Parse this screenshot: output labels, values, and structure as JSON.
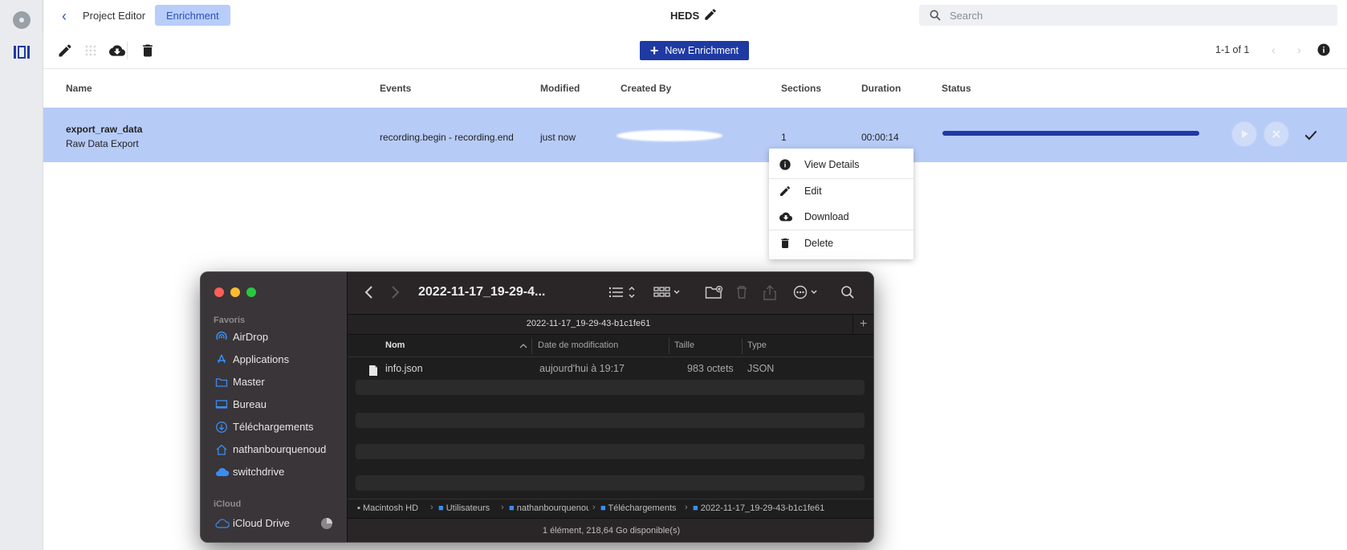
{
  "header": {
    "breadcrumb_project_editor": "Project Editor",
    "breadcrumb_enrichment": "Enrichment",
    "project_title": "HEDS",
    "search_placeholder": "Search"
  },
  "toolbar": {
    "new_enrichment_label": "New Enrichment",
    "pager_text": "1-1 of 1"
  },
  "table": {
    "columns": [
      "Name",
      "Events",
      "Modified",
      "Created By",
      "Sections",
      "Duration",
      "Status"
    ],
    "rows": [
      {
        "name": "export_raw_data",
        "subtitle": "Raw Data Export",
        "events": "recording.begin - recording.end",
        "modified": "just now",
        "sections": "1",
        "duration": "00:00:14",
        "progress": 1.0
      }
    ]
  },
  "context_menu": {
    "items": [
      "View Details",
      "Edit",
      "Download",
      "Delete"
    ]
  },
  "finder": {
    "title": "2022-11-17_19-29-4...",
    "tab_label": "2022-11-17_19-29-43-b1c1fe61",
    "sidebar": {
      "favorites_label": "Favoris",
      "favorites": [
        "AirDrop",
        "Applications",
        "Master",
        "Bureau",
        "Téléchargements",
        "nathanbourquenoud",
        "switchdrive"
      ],
      "icloud_label": "iCloud",
      "icloud": [
        "iCloud Drive"
      ]
    },
    "columns": [
      "Nom",
      "Date de modification",
      "Taille",
      "Type"
    ],
    "files": [
      {
        "name": "info.json",
        "modified": "aujourd'hui à 19:17",
        "size": "983 octets",
        "type": "JSON"
      }
    ],
    "path": [
      "Macintosh HD",
      "Utilisateurs",
      "nathanbourquenoud",
      "Téléchargements",
      "2022-11-17_19-29-43-b1c1fe61"
    ],
    "status": "1 élément, 218,64 Go disponible(s)"
  },
  "colors": {
    "accent": "#1f3aa3",
    "row_highlight": "#b7cbf7",
    "chip": "#b8cdf9"
  }
}
